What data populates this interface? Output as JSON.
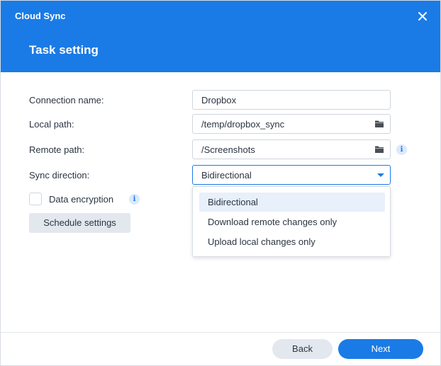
{
  "window": {
    "app_title": "Cloud Sync",
    "page_title": "Task setting"
  },
  "form": {
    "connection_name": {
      "label": "Connection name:",
      "value": "Dropbox"
    },
    "local_path": {
      "label": "Local path:",
      "value": "/temp/dropbox_sync"
    },
    "remote_path": {
      "label": "Remote path:",
      "value": "/Screenshots"
    },
    "sync_direction": {
      "label": "Sync direction:",
      "value": "Bidirectional",
      "options": [
        "Bidirectional",
        "Download remote changes only",
        "Upload local changes only"
      ]
    },
    "data_encryption": {
      "label": "Data encryption",
      "checked": false
    },
    "schedule_button": "Schedule settings"
  },
  "footer": {
    "back_label": "Back",
    "next_label": "Next"
  },
  "icons": {
    "close": "close-icon",
    "folder": "folder-icon",
    "info": "info-icon",
    "caret": "chevron-down-icon"
  },
  "colors": {
    "accent": "#1a7be6",
    "selected_option_bg": "#e7f0fb",
    "secondary_button_bg": "#e3e8ef"
  }
}
